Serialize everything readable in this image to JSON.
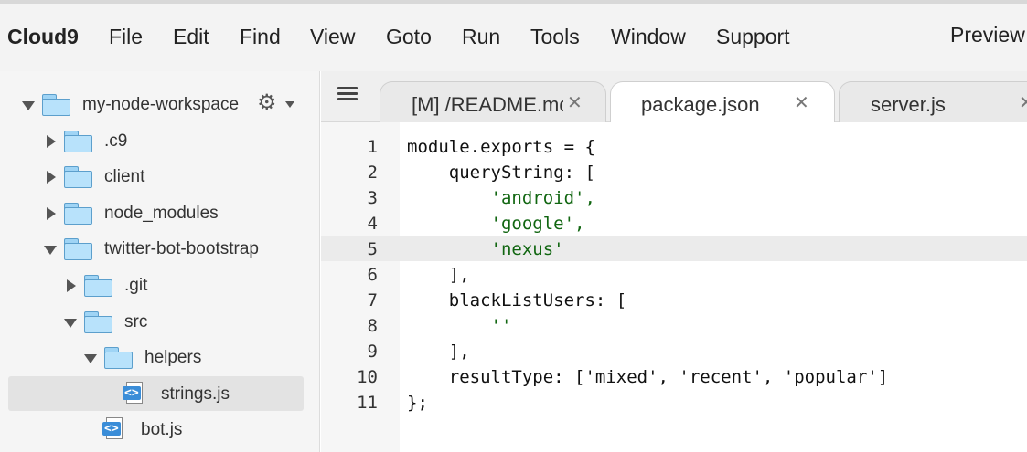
{
  "menubar": {
    "brand": "Cloud9",
    "items": [
      "File",
      "Edit",
      "Find",
      "View",
      "Goto",
      "Run",
      "Tools",
      "Window",
      "Support"
    ],
    "preview": "Preview"
  },
  "sidebar": {
    "workspace": "my-node-workspace",
    "tree": [
      {
        "label": ".c9",
        "type": "folder",
        "expanded": false
      },
      {
        "label": "client",
        "type": "folder",
        "expanded": false
      },
      {
        "label": "node_modules",
        "type": "folder",
        "expanded": false
      },
      {
        "label": "twitter-bot-bootstrap",
        "type": "folder",
        "expanded": true
      },
      {
        "label": ".git",
        "type": "folder",
        "expanded": false
      },
      {
        "label": "src",
        "type": "folder",
        "expanded": true
      },
      {
        "label": "helpers",
        "type": "folder",
        "expanded": true
      },
      {
        "label": "strings.js",
        "type": "file",
        "selected": true
      },
      {
        "label": "bot.js",
        "type": "file"
      }
    ]
  },
  "tabs": [
    {
      "label": "[M] /README.md",
      "active": false
    },
    {
      "label": "package.json",
      "active": true
    },
    {
      "label": "server.js",
      "active": false
    }
  ],
  "editor": {
    "current_line": 5,
    "lines": [
      {
        "n": "1",
        "code": "module.exports = {"
      },
      {
        "n": "2",
        "code": "    queryString: ["
      },
      {
        "n": "3",
        "code": "        'android',"
      },
      {
        "n": "4",
        "code": "        'google',"
      },
      {
        "n": "5",
        "code": "        'nexus'"
      },
      {
        "n": "6",
        "code": "    ],"
      },
      {
        "n": "7",
        "code": "    blackListUsers: ["
      },
      {
        "n": "8",
        "code": "        ''"
      },
      {
        "n": "9",
        "code": "    ],"
      },
      {
        "n": "10",
        "code": "    resultType: ['mixed', 'recent', 'popular']"
      },
      {
        "n": "11",
        "code": "};"
      }
    ]
  },
  "colors": {
    "string": "#116611",
    "folder": "#b8e2fb",
    "js_badge": "#3a8dd8"
  }
}
